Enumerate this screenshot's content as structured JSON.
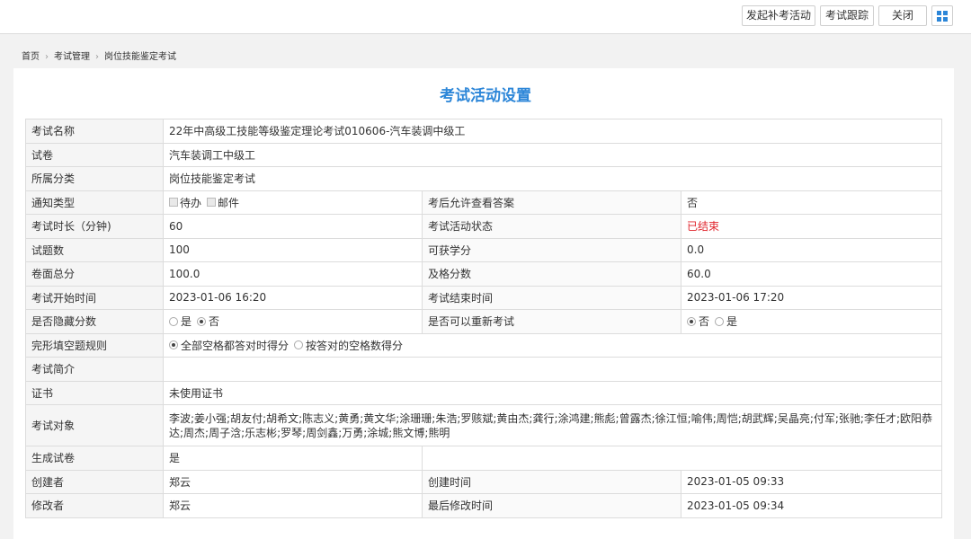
{
  "toolbar": {
    "makeup_label": "发起补考活动",
    "tracking_label": "考试跟踪",
    "close_label": "关闭"
  },
  "breadcrumb": [
    "首页",
    "考试管理",
    "岗位技能鉴定考试"
  ],
  "page_title": "考试活动设置",
  "form": {
    "exam_name_label": "考试名称",
    "exam_name": "22年中高级工技能等级鉴定理论考试010606-汽车装调中级工",
    "paper_label": "试卷",
    "paper": "汽车装调工中级工",
    "category_label": "所属分类",
    "category": "岗位技能鉴定考试",
    "notify_label": "通知类型",
    "notify_options": [
      "待办",
      "邮件"
    ],
    "view_answer_label": "考后允许查看答案",
    "view_answer": "否",
    "duration_label": "考试时长（分钟)",
    "duration": "60",
    "status_label": "考试活动状态",
    "status": "已结束",
    "question_count_label": "试题数",
    "question_count": "100",
    "credit_label": "可获学分",
    "credit": "0.0",
    "total_score_label": "卷面总分",
    "total_score": "100.0",
    "pass_score_label": "及格分数",
    "pass_score": "60.0",
    "start_label": "考试开始时间",
    "start": "2023-01-06 16:20",
    "end_label": "考试结束时间",
    "end": "2023-01-06 17:20",
    "hide_score_label": "是否隐藏分数",
    "hide_score_yes": "是",
    "hide_score_no": "否",
    "retake_label": "是否可以重新考试",
    "retake_no": "否",
    "retake_yes": "是",
    "cloze_label": "完形填空题规则",
    "cloze_opt1": "全部空格都答对时得分",
    "cloze_opt2": "按答对的空格数得分",
    "intro_label": "考试简介",
    "intro": "",
    "cert_label": "证书",
    "cert": "未使用证书",
    "targets_label": "考试对象",
    "targets": "李波;姜小强;胡友付;胡希文;陈志义;黄勇;黄文华;涂珊珊;朱浩;罗赅斌;黄由杰;龚行;涂鸿建;熊彪;曾露杰;徐江恒;喻伟;周恺;胡武辉;吴晶亮;付军;张驰;李任才;欧阳恭达;周杰;周子浛;乐志彬;罗琴;周剑鑫;万勇;涂城;熊文博;熊明",
    "gen_paper_label": "生成试卷",
    "gen_paper": "是",
    "creator_label": "创建者",
    "creator": "郑云",
    "created_label": "创建时间",
    "created": "2023-01-05 09:33",
    "modifier_label": "修改者",
    "modifier": "郑云",
    "modified_label": "最后修改时间",
    "modified": "2023-01-05 09:34"
  },
  "colors": {
    "accent": "#2c86d8",
    "status_red": "#e0242c"
  }
}
